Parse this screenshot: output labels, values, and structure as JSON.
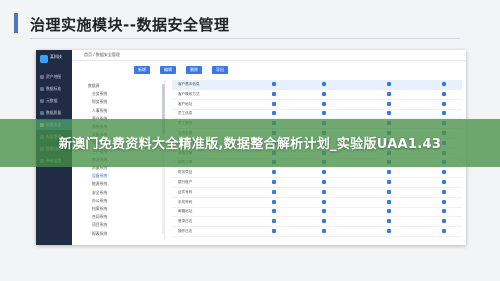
{
  "slide": {
    "title": "治理实施模块--数据安全管理"
  },
  "banner": {
    "text": "新澳门免费资料大全精准版,数据整合解析计划_实验版UAA1.43"
  },
  "colors": {
    "accent": "#3b78e7",
    "sidebar": "#1f2c44",
    "banner": "#469146"
  },
  "app": {
    "logo_text": "某科技",
    "breadcrumb": "首页 / 数据安全管理",
    "sidebar": [
      {
        "label": "资产地图",
        "icon": "map-icon"
      },
      {
        "label": "数据标准",
        "icon": "doc-icon"
      },
      {
        "label": "元数据",
        "icon": "db-icon"
      },
      {
        "label": "数据质量",
        "icon": "check-icon"
      },
      {
        "label": "数据安全",
        "icon": "shield-icon"
      },
      {
        "label": "权限管理",
        "icon": "lock-icon"
      },
      {
        "label": "数据分级",
        "icon": "layers-icon"
      },
      {
        "label": "系统设置",
        "icon": "gear-icon"
      }
    ],
    "toolbar": [
      "新增",
      "编辑",
      "删除",
      "导出"
    ],
    "tree": [
      "数据源",
      "业务系统",
      "财务系统",
      "人事系统",
      "客户系统",
      "营销系统",
      "采购系统",
      "库存系统",
      "生产系统",
      "物流系统",
      "质量系统",
      "设备系统",
      "能源系统",
      "安全系统",
      "办公系统",
      "档案系统",
      "合同系统",
      "项目系统",
      "报表系统"
    ],
    "rows": [
      "客户基本信息",
      "客户联系方式",
      "客户地址",
      "员工信息",
      "员工薪资",
      "合同金额",
      "供应商信息",
      "采购订单",
      "销售订单",
      "财务凭证",
      "银行账户",
      "证件号码",
      "手机号码",
      "邮箱地址",
      "登录日志",
      "操作日志"
    ]
  }
}
